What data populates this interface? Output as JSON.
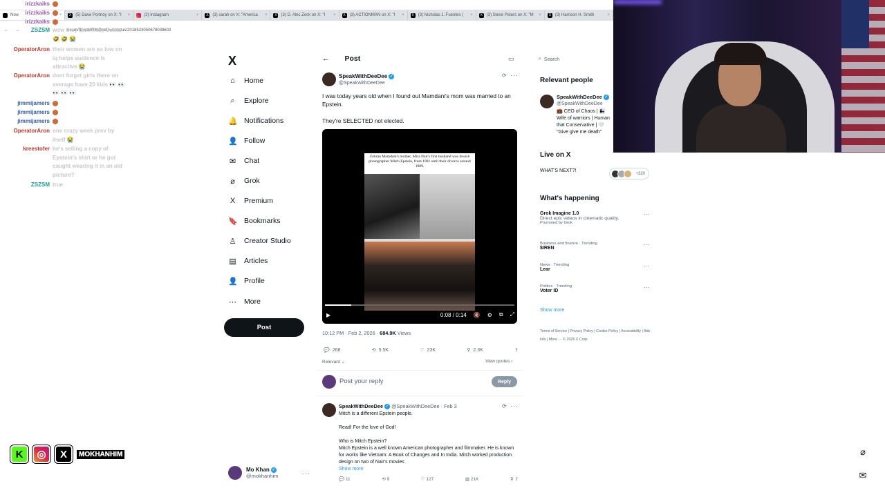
{
  "browser": {
    "tabs": [
      {
        "label": "Now",
        "icon": "chrome-icon"
      },
      {
        "label": "(5) Dave Portnoy on X: \"I",
        "icon": "x-icon"
      },
      {
        "label": "(2) Instagram",
        "icon": "instagram-icon"
      },
      {
        "label": "(3) sarah on X: \"America",
        "icon": "x-icon"
      },
      {
        "label": "(3) D. Alec Zeck on X: \"I",
        "icon": "x-icon"
      },
      {
        "label": "(3) ACTIONMAN on X: \"I",
        "icon": "x-icon"
      },
      {
        "label": "(3) Nicholas J. Fuentes (",
        "icon": "x-icon"
      },
      {
        "label": "(3) Steve Peters on X: \"M",
        "icon": "x-icon"
      },
      {
        "label": "(3) Harrison H. Smith",
        "icon": "x-icon"
      }
    ],
    "url": "x.com/SpeakWithDeeDee/status/2018523050678038602"
  },
  "chat": [
    {
      "user": "irizzkaiks",
      "color": "#9b59b6",
      "msg": ""
    },
    {
      "user": "irizzkaiks",
      "color": "#9b59b6",
      "msg": ""
    },
    {
      "user": "irizzkaiks",
      "color": "#9b59b6",
      "msg": ""
    },
    {
      "user": "ZSZSM",
      "color": "#16a085",
      "msg": "wow they didn't say Jokes 🤣 🤣 😭"
    },
    {
      "user": "OperatorAron",
      "color": "#c0392b",
      "msg": "their women are so low on iq helps audience is attractive 😭"
    },
    {
      "user": "OperatorAron",
      "color": "#c0392b",
      "msg": "dont forget girls there on average have 20 kids 👀 👀 👀 👀 👀"
    },
    {
      "user": "jimmijamers",
      "color": "#2e5cb8",
      "msg": ""
    },
    {
      "user": "jimmijamers",
      "color": "#2e5cb8",
      "msg": ""
    },
    {
      "user": "jimmijamers",
      "color": "#2e5cb8",
      "msg": ""
    },
    {
      "user": "OperatorAron",
      "color": "#c0392b",
      "msg": "one crazy week prev by itself 😭"
    },
    {
      "user": "kreestofer",
      "color": "#c0392b",
      "msg": "he's selling a copy of Epstein's shirt or he got caught wearing it in an old picture?"
    },
    {
      "user": "ZSZSM",
      "color": "#16a085",
      "msg": "true"
    }
  ],
  "sidebar": {
    "logo": "X",
    "items": [
      {
        "label": "Home",
        "icon": "home-icon",
        "glyph": "⌂"
      },
      {
        "label": "Explore",
        "icon": "search-icon",
        "glyph": "⌕"
      },
      {
        "label": "Notifications",
        "icon": "bell-icon",
        "glyph": "🔔"
      },
      {
        "label": "Follow",
        "icon": "follow-icon",
        "glyph": "👤"
      },
      {
        "label": "Chat",
        "icon": "mail-icon",
        "glyph": "✉"
      },
      {
        "label": "Grok",
        "icon": "grok-icon",
        "glyph": "⌀"
      },
      {
        "label": "Premium",
        "icon": "x-icon",
        "glyph": "X"
      },
      {
        "label": "Bookmarks",
        "icon": "bookmark-icon",
        "glyph": "🔖"
      },
      {
        "label": "Creator Studio",
        "icon": "creator-icon",
        "glyph": "♙"
      },
      {
        "label": "Articles",
        "icon": "articles-icon",
        "glyph": "▤"
      },
      {
        "label": "Profile",
        "icon": "profile-icon",
        "glyph": "👤"
      },
      {
        "label": "More",
        "icon": "more-icon",
        "glyph": "⋯"
      }
    ],
    "post_button": "Post",
    "account": {
      "name": "Mo Khan",
      "handle": "@mokhanhim",
      "more": "···"
    }
  },
  "main": {
    "header_title": "Post",
    "tweet": {
      "name": "SpeakWithDeeDee",
      "handle": "@SpeakWithDeeDee",
      "text1": "I was today years old when I found out Mamdani's mom was married to an Epstein.",
      "text2": "They're SELECTED not elected.",
      "video_caption": "Zohran Mamdani's mother, Mira Nair's first husband was Jewish photographer Mitch Epstein, from 1981 until their divorce around 1989.",
      "video_time": "0:08 / 0:14",
      "video_progress": 0.14,
      "time": "10:12 PM · Feb 2, 2026 · ",
      "views": "684.9K",
      "views_label": " Views",
      "replies": "268",
      "reposts": "5.5K",
      "likes": "23K",
      "bookmarks": "2.3K",
      "sort": "Relevant",
      "view_quotes": "View quotes"
    },
    "reply_placeholder": "Post your reply",
    "reply_button": "Reply",
    "tweet2": {
      "name": "SpeakWithDeeDee",
      "rest": "@SpeakWithDeeDee · Feb 3",
      "p1": "Mitch is a different Epstein people.",
      "p2": "Read! For the love of God!",
      "p3a": "Who is Mitch Epstein?",
      "p3b": "Mitch Epstein is a well known American photographer and filmmaker. He is known for works like Vietnam: A Book of Changes and In India. Mitch worked production design on two of Nair's movies",
      "show_more": "Show more",
      "replies": "11",
      "reposts": "9",
      "likes": "127",
      "views": "21K"
    }
  },
  "right": {
    "search_placeholder": "Search",
    "relevant_title": "Relevant people",
    "person": {
      "name": "SpeakWithDeeDee",
      "handle": "@SpeakWithDeeDee",
      "bio": "💼 CEO of Chaos | 👨‍👧 Wife of warriors | Human that Conservative | 🤍 \"Give give me death\""
    },
    "live_title": "Live on X",
    "live_item": "WHAT'S NEXT?!",
    "live_count": "+320",
    "happening_title": "What's happening",
    "trends": [
      {
        "cat": "",
        "label": "Grok Imagine 1.0",
        "desc": "Direct epic videos in cinematic quality.",
        "promo": "Promoted by Grok"
      },
      {
        "cat": "Business and finance · Trending",
        "label": "$IREN",
        "desc": "",
        "promo": ""
      },
      {
        "cat": "News · Trending",
        "label": "Lear",
        "desc": "",
        "promo": ""
      },
      {
        "cat": "Politics · Trending",
        "label": "Voter ID",
        "desc": "",
        "promo": ""
      }
    ],
    "show_more": "Show more",
    "footer": "Terms of Service  |  Privacy Policy  |  Cookie Policy  |  Accessibility  |  Ads info  |  More ···  © 2026 X Corp."
  },
  "stream": {
    "handle": "MOKHANHIM"
  }
}
